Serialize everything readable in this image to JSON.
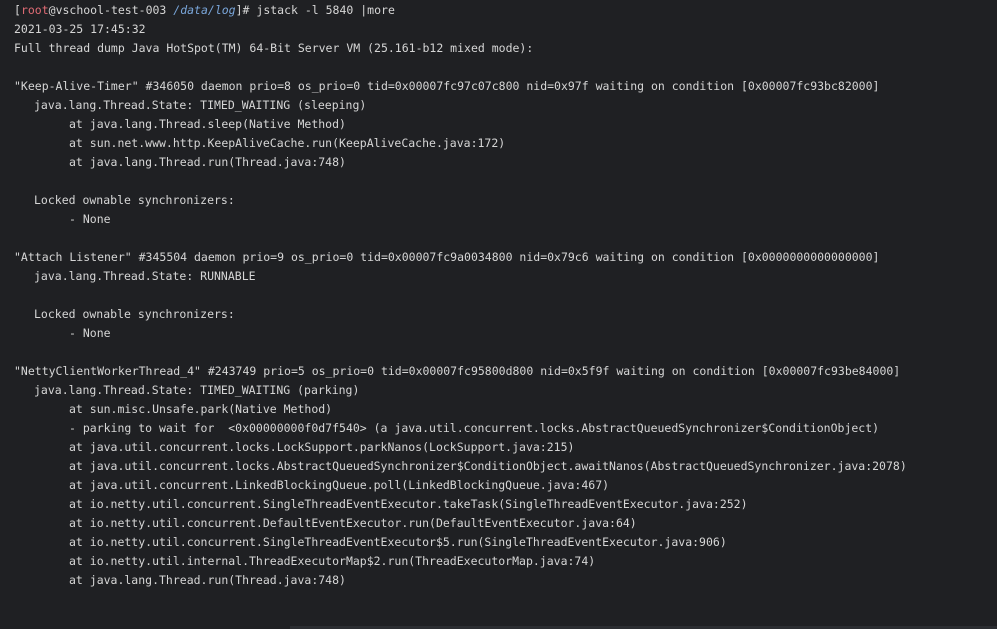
{
  "prompt": {
    "open_bracket": "[",
    "user": "root",
    "at_host": "@vschool-test-003",
    "path": "/data/log",
    "close_bracket": "]",
    "hash": "# ",
    "command": "jstack -l 5840 |more"
  },
  "lines": {
    "timestamp": "2021-03-25 17:45:32",
    "dump_header": "Full thread dump Java HotSpot(TM) 64-Bit Server VM (25.161-b12 mixed mode):",
    "t1_header": "\"Keep-Alive-Timer\" #346050 daemon prio=8 os_prio=0 tid=0x00007fc97c07c800 nid=0x97f waiting on condition [0x00007fc93bc82000]",
    "t1_state": "java.lang.Thread.State: TIMED_WAITING (sleeping)",
    "t1_f1": "at java.lang.Thread.sleep(Native Method)",
    "t1_f2": "at sun.net.www.http.KeepAliveCache.run(KeepAliveCache.java:172)",
    "t1_f3": "at java.lang.Thread.run(Thread.java:748)",
    "t1_locked": "Locked ownable synchronizers:",
    "t1_none": "- None",
    "t2_header": "\"Attach Listener\" #345504 daemon prio=9 os_prio=0 tid=0x00007fc9a0034800 nid=0x79c6 waiting on condition [0x0000000000000000]",
    "t2_state": "java.lang.Thread.State: RUNNABLE",
    "t2_locked": "Locked ownable synchronizers:",
    "t2_none": "- None",
    "t3_header": "\"NettyClientWorkerThread_4\" #243749 prio=5 os_prio=0 tid=0x00007fc95800d800 nid=0x5f9f waiting on condition [0x00007fc93be84000]",
    "t3_state": "java.lang.Thread.State: TIMED_WAITING (parking)",
    "t3_f1": "at sun.misc.Unsafe.park(Native Method)",
    "t3_f2": "- parking to wait for  <0x00000000f0d7f540> (a java.util.concurrent.locks.AbstractQueuedSynchronizer$ConditionObject)",
    "t3_f3": "at java.util.concurrent.locks.LockSupport.parkNanos(LockSupport.java:215)",
    "t3_f4": "at java.util.concurrent.locks.AbstractQueuedSynchronizer$ConditionObject.awaitNanos(AbstractQueuedSynchronizer.java:2078)",
    "t3_f5": "at java.util.concurrent.LinkedBlockingQueue.poll(LinkedBlockingQueue.java:467)",
    "t3_f6": "at io.netty.util.concurrent.SingleThreadEventExecutor.takeTask(SingleThreadEventExecutor.java:252)",
    "t3_f7": "at io.netty.util.concurrent.DefaultEventExecutor.run(DefaultEventExecutor.java:64)",
    "t3_f8": "at io.netty.util.concurrent.SingleThreadEventExecutor$5.run(SingleThreadEventExecutor.java:906)",
    "t3_f9": "at io.netty.util.internal.ThreadExecutorMap$2.run(ThreadExecutorMap.java:74)",
    "t3_f10": "at java.lang.Thread.run(Thread.java:748)"
  },
  "colors": {
    "background": "#1f2023",
    "text": "#d6d6d6",
    "prompt_user": "#e06c75",
    "prompt_path": "#7aa6da"
  }
}
